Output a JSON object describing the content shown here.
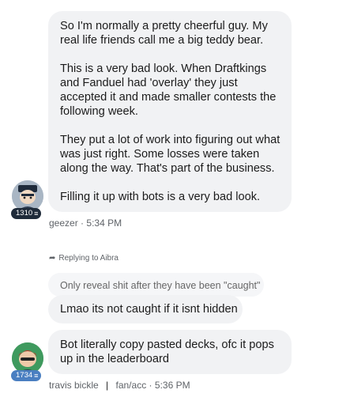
{
  "messages": {
    "first": {
      "text": "So I'm normally a pretty cheerful guy.  My real life friends call me a big teddy bear.\n\nThis is a very bad look.  When Draftkings and Fanduel had 'overlay' they just accepted it and made smaller contests the following week.\n\nThey put a lot of work into figuring out what was just right.  Some losses were taken along the way.  That's part of the business.\n\nFilling it up with bots is a very bad look.",
      "author": "geezer",
      "sep": "·",
      "time": "5:34 PM",
      "badge": "1310",
      "badge_icon": "bars-icon",
      "badge_color": "#1f2b3a"
    },
    "reply": {
      "replying_label": "Replying to Aibra",
      "quoted": "Only reveal shit after they have been \"caught\"",
      "text": "Lmao its not caught if it isnt hidden"
    },
    "second": {
      "text": "Bot literally copy pasted decks, ofc it pops up in the leaderboard",
      "author": "travis bickle",
      "divider": "|",
      "role": "fan/acc",
      "sep": "·",
      "time": "5:36 PM",
      "badge": "1734",
      "badge_icon": "bars-icon",
      "badge_color": "#4a7fc1"
    }
  }
}
